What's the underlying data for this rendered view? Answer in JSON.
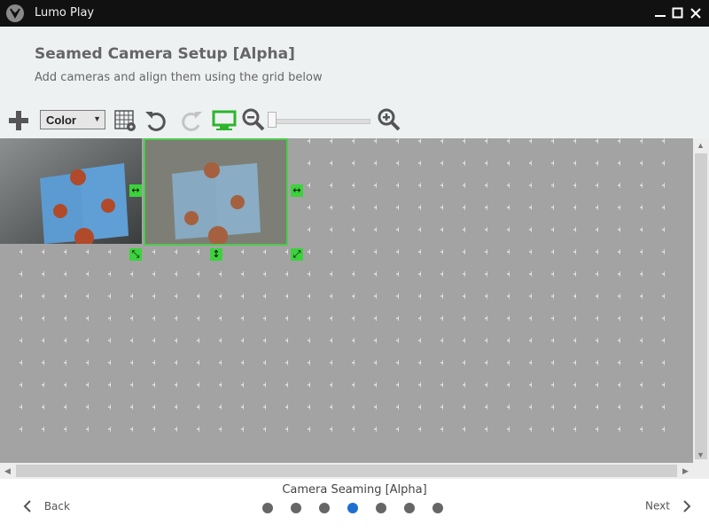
{
  "window": {
    "title": "Lumo Play"
  },
  "header": {
    "title": "Seamed Camera Setup [Alpha]",
    "subtitle": "Add cameras and align them using the grid below"
  },
  "toolbar": {
    "color_mode": "Color",
    "zoom_level": 0
  },
  "footer": {
    "step_title": "Camera Seaming [Alpha]",
    "back_label": "Back",
    "next_label": "Next",
    "steps_total": 7,
    "active_step": 4
  },
  "colors": {
    "accent_green": "#3cd23c",
    "active_dot": "#1e6fd0",
    "canvas_gray": "#a3a3a3"
  },
  "icons": [
    "add-camera-icon",
    "grid-icon",
    "undo-icon",
    "redo-icon",
    "display-icon",
    "zoom-out-icon",
    "zoom-in-icon",
    "minimize-icon",
    "maximize-icon",
    "close-icon",
    "chevron-left-icon",
    "chevron-right-icon"
  ]
}
